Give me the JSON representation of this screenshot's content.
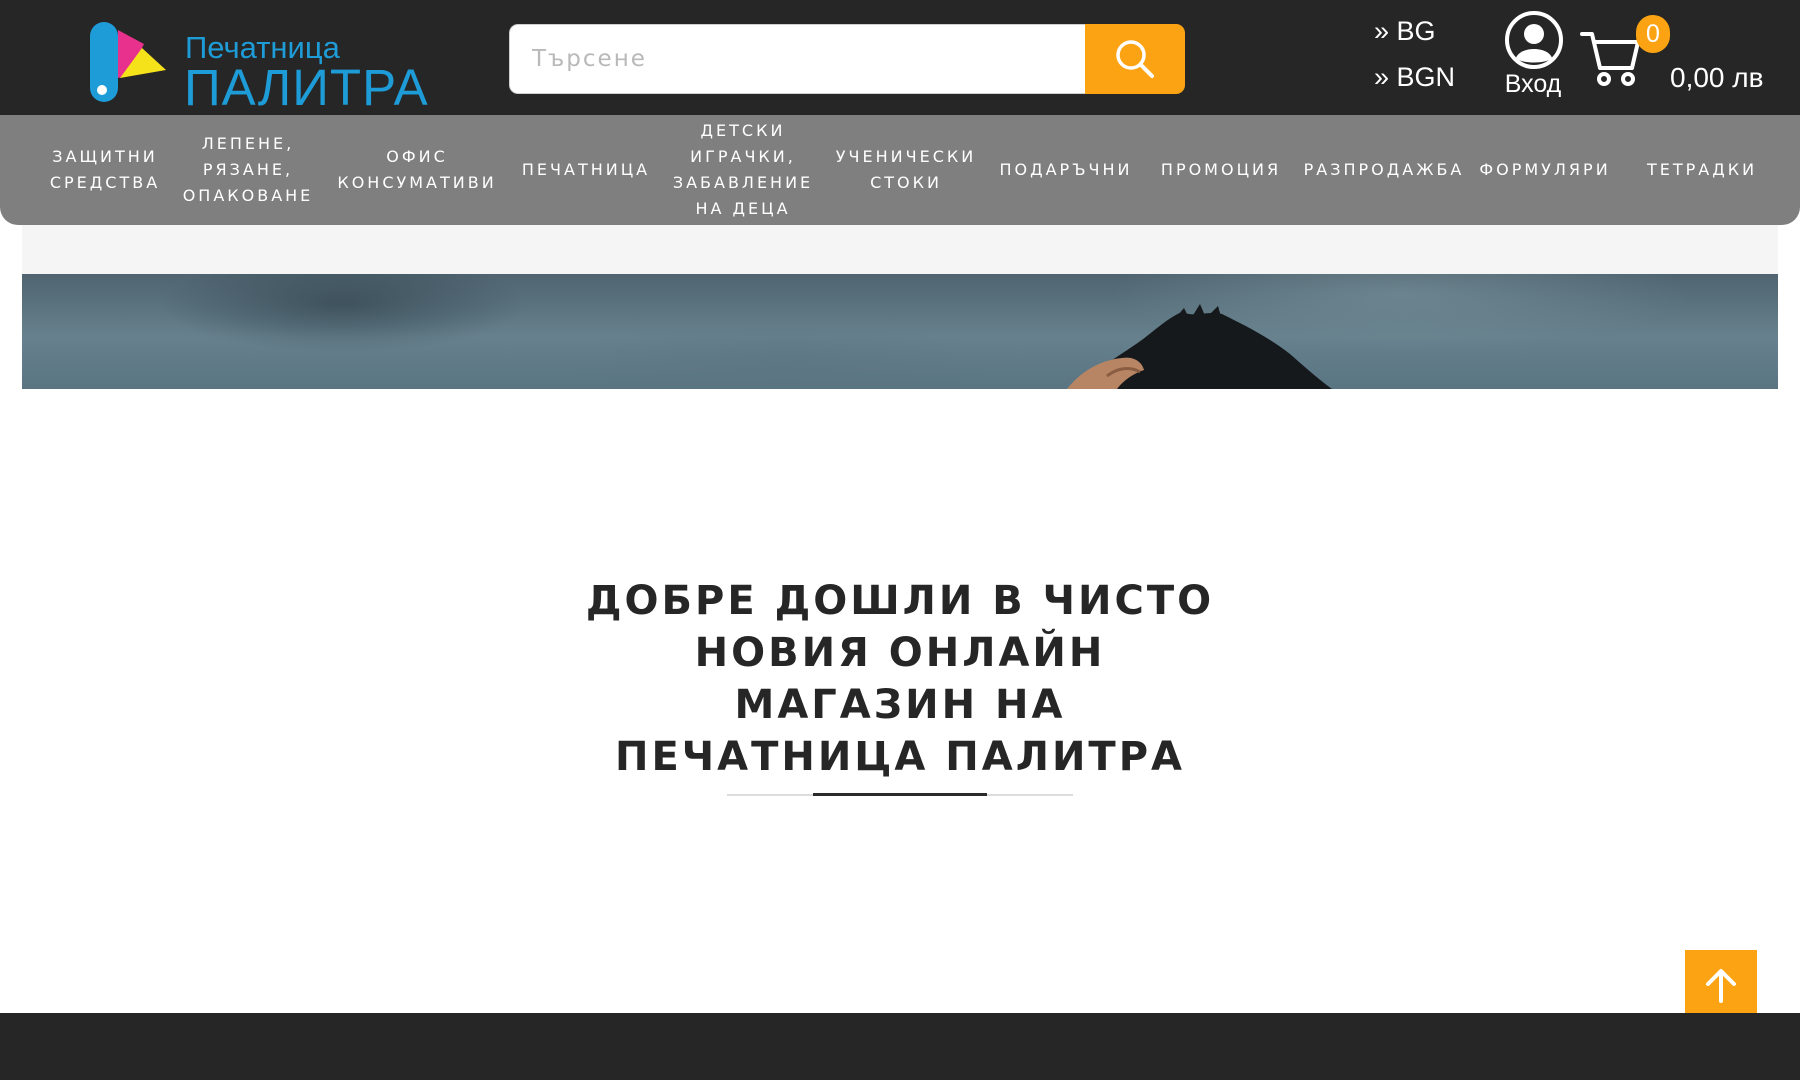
{
  "header": {
    "logo": {
      "line1": "Печатница",
      "line2": "ПАЛИТРА"
    },
    "search": {
      "placeholder": "Търсене",
      "value": ""
    },
    "language": {
      "label": "» BG"
    },
    "currency": {
      "label": "» BGN"
    },
    "account": {
      "label": "Вход"
    },
    "cart": {
      "count": "0",
      "total": "0,00 лв"
    }
  },
  "nav": {
    "items": [
      {
        "label": "ЗАЩИТНИ\nСРЕДСТВА"
      },
      {
        "label": "ЛЕПЕНЕ,\nРЯЗАНЕ,\nОПАКОВАНЕ"
      },
      {
        "label": "ОФИС\nКОНСУМАТИВИ"
      },
      {
        "label": "ПЕЧАТНИЦА"
      },
      {
        "label": "ДЕТСКИ\nИГРАЧКИ,\nЗАБАВЛЕНИЕ\nНА ДЕЦА"
      },
      {
        "label": "УЧЕНИЧЕСКИ\nСТОКИ"
      },
      {
        "label": "ПОДАРЪЧНИ"
      },
      {
        "label": "ПРОМОЦИЯ"
      },
      {
        "label": "РАЗПРОДАЖБА"
      },
      {
        "label": "ФОРМУЛЯРИ"
      },
      {
        "label": "ТЕТРАДКИ"
      }
    ]
  },
  "main": {
    "welcome_heading": "ДОБРЕ ДОШЛИ В ЧИСТО НОВИЯ ОНЛАЙН МАГАЗИН НА ПЕЧАТНИЦА ПАЛИТРА"
  },
  "icons": {
    "search": "search-icon",
    "account": "user-circle-icon",
    "cart": "shopping-cart-icon",
    "back_to_top": "arrow-up-icon"
  },
  "colors": {
    "header_bg": "#262626",
    "nav_bg": "#7f7f7f",
    "accent": "#fca313",
    "brand_blue": "#1e9cd7",
    "heading_text": "#262626",
    "footer_bg": "#262626"
  }
}
